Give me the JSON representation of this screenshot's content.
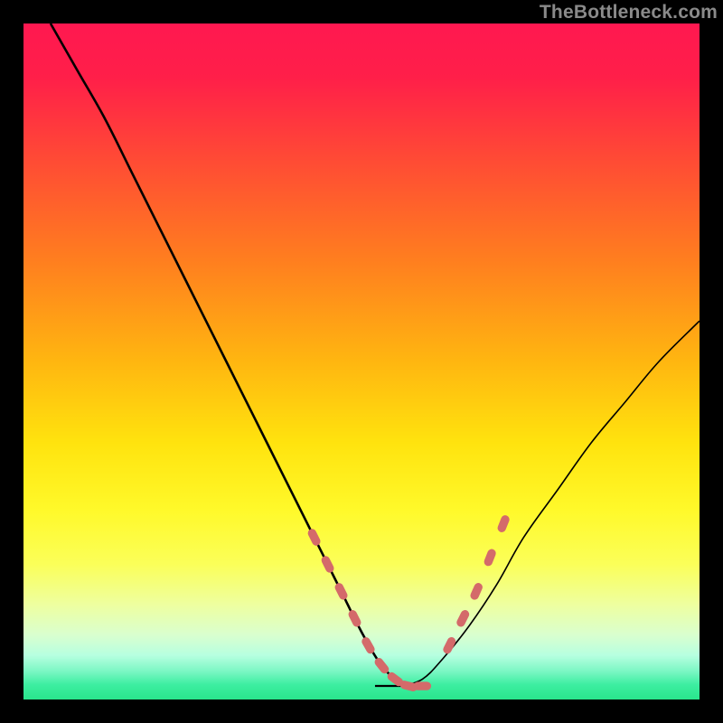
{
  "watermark": "TheBottleneck.com",
  "gradient_stops": [
    {
      "offset": 0.0,
      "color": "#ff1850"
    },
    {
      "offset": 0.08,
      "color": "#ff1f49"
    },
    {
      "offset": 0.2,
      "color": "#ff4a35"
    },
    {
      "offset": 0.35,
      "color": "#ff7e1f"
    },
    {
      "offset": 0.5,
      "color": "#ffb610"
    },
    {
      "offset": 0.62,
      "color": "#ffe30e"
    },
    {
      "offset": 0.72,
      "color": "#fff92a"
    },
    {
      "offset": 0.8,
      "color": "#fbff59"
    },
    {
      "offset": 0.86,
      "color": "#eeffa0"
    },
    {
      "offset": 0.905,
      "color": "#d9ffcf"
    },
    {
      "offset": 0.935,
      "color": "#b6ffe0"
    },
    {
      "offset": 0.958,
      "color": "#7cf7c4"
    },
    {
      "offset": 0.978,
      "color": "#3deea1"
    },
    {
      "offset": 1.0,
      "color": "#29e58c"
    }
  ],
  "chart_data": {
    "type": "line",
    "title": "",
    "xlabel": "",
    "ylabel": "",
    "xlim": [
      0,
      100
    ],
    "ylim": [
      0,
      100
    ],
    "series": [
      {
        "name": "left-curve",
        "x": [
          4,
          8,
          12,
          16,
          20,
          24,
          28,
          32,
          36,
          40,
          44,
          47,
          50,
          53,
          56
        ],
        "values": [
          100,
          93,
          86,
          78,
          70,
          62,
          54,
          46,
          38,
          30,
          22,
          16,
          10,
          5,
          2
        ]
      },
      {
        "name": "right-curve",
        "x": [
          56,
          59,
          62,
          66,
          70,
          74,
          79,
          84,
          89,
          94,
          100
        ],
        "values": [
          2,
          3,
          6,
          11,
          17,
          24,
          31,
          38,
          44,
          50,
          56
        ]
      },
      {
        "name": "markers-left",
        "x": [
          43,
          45,
          47,
          49,
          51,
          53,
          55,
          57,
          59
        ],
        "values": [
          24,
          20,
          16,
          12,
          8,
          5,
          3,
          2,
          2
        ]
      },
      {
        "name": "markers-right",
        "x": [
          63,
          65,
          67,
          69,
          71
        ],
        "values": [
          8,
          12,
          16,
          21,
          26
        ]
      }
    ],
    "marker_color": "#d46a6a",
    "line_color": "#000000"
  }
}
